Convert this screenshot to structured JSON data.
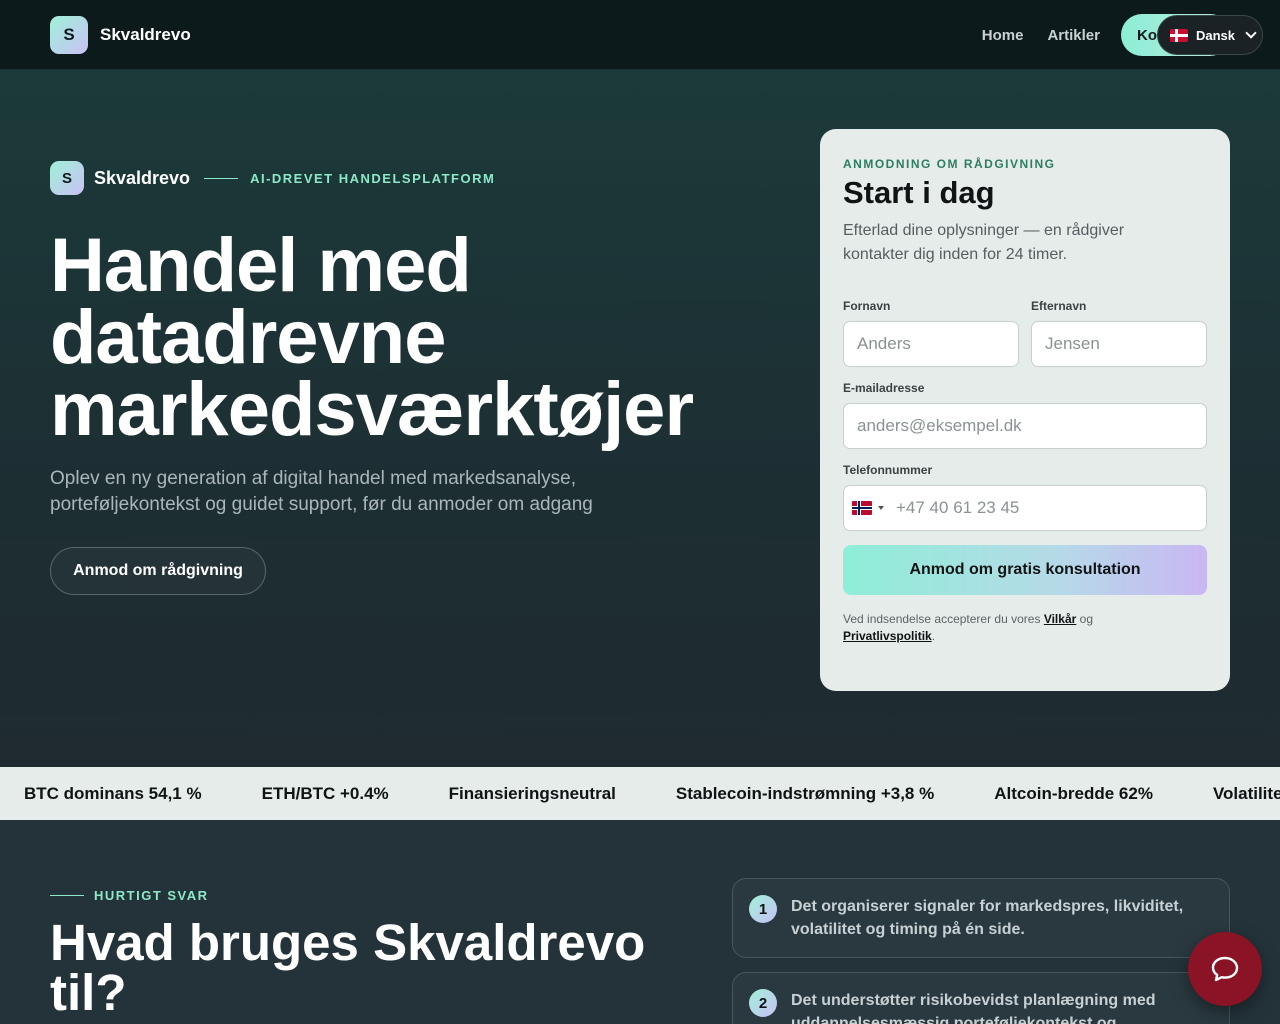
{
  "header": {
    "brand_initial": "S",
    "brand_name": "Skvaldrevo",
    "nav": [
      "Home",
      "Artikler"
    ],
    "contact_label": "Kontakt",
    "language": "Dansk"
  },
  "hero": {
    "brand_initial": "S",
    "brand_name": "Skvaldrevo",
    "tagline": "AI-DREVET HANDELSPLATFORM",
    "title": "Handel med datadrevne markedsværktøjer",
    "subtitle": "Oplev en ny generation af digital handel med markedsanalyse, porteføljekontekst og guidet support, før du anmoder om adgang",
    "cta_label": "Anmod om rådgivning"
  },
  "form": {
    "eyebrow": "ANMODNING OM RÅDGIVNING",
    "title": "Start i dag",
    "description": "Efterlad dine oplysninger — en rådgiver kontakter dig inden for 24 timer.",
    "first_name_label": "Fornavn",
    "first_name_placeholder": "Anders",
    "last_name_label": "Efternavn",
    "last_name_placeholder": "Jensen",
    "email_label": "E-mailadresse",
    "email_placeholder": "anders@eksempel.dk",
    "phone_label": "Telefonnummer",
    "phone_placeholder": "+47 40 61 23 45",
    "submit_label": "Anmod om gratis konsultation",
    "legal_prefix": "Ved indsendelse accepterer du vores",
    "terms_link": "Vilkår",
    "legal_and": "og",
    "privacy_link": "Privatlivspolitik",
    "legal_suffix": "."
  },
  "ticker": [
    "BTC dominans 54,1 %",
    "ETH/BTC +0.4%",
    "Finansieringsneutral",
    "Stablecoin-indstrømning +3,8 %",
    "Altcoin-bredde 62%",
    "Volatilitet"
  ],
  "faq": {
    "eyebrow": "HURTIGT SVAR",
    "title": "Hvad bruges Skvaldrevo til?",
    "items": [
      {
        "num": "1",
        "text": "Det organiserer signaler for markedspres, likviditet, volatilitet og timing på én side."
      },
      {
        "num": "2",
        "text": "Det understøtter risikobevidst planlægning med uddannelsesmæssig porteføljekontekst og"
      }
    ]
  }
}
